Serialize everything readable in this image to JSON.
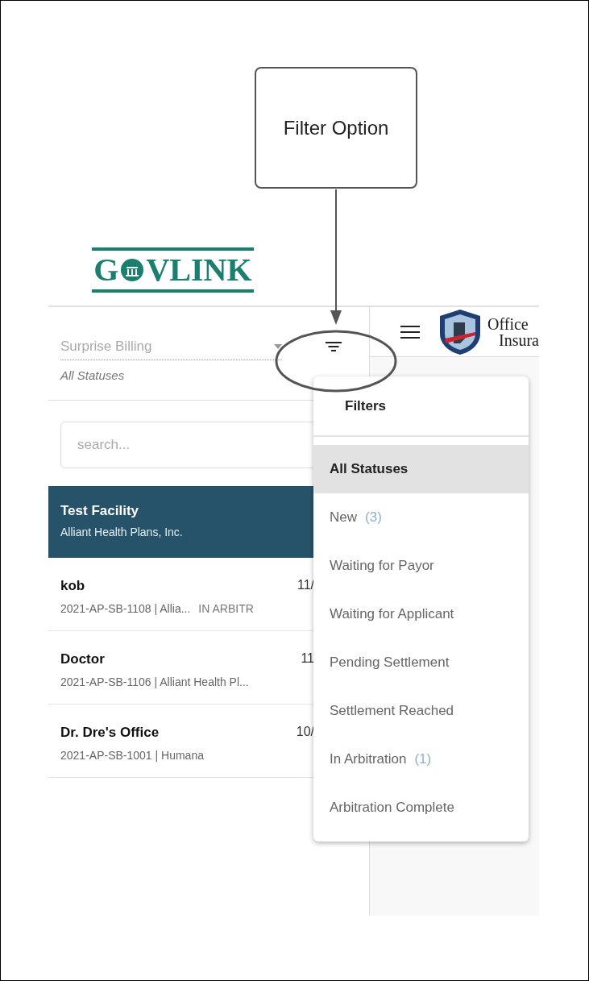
{
  "annotation": {
    "label": "Filter Option"
  },
  "logo": {
    "text_before": "G",
    "text_after": "VLINK"
  },
  "header": {
    "agency_name_lines": [
      "Office",
      "Insura"
    ]
  },
  "sidebar": {
    "program_select": {
      "value": "Surprise Billing"
    },
    "status_label": "All Statuses",
    "search": {
      "placeholder": "search..."
    },
    "cases": [
      {
        "title": "Test Facility",
        "subtitle": "Alliant Health Plans, Inc.",
        "selected": true
      },
      {
        "title": "kob",
        "date": "11/",
        "subtitle": "2021-AP-SB-1108 | Allia...",
        "status": "IN ARBITR",
        "selected": false
      },
      {
        "title": "Doctor",
        "date": "11",
        "subtitle": "2021-AP-SB-1106 | Alliant Health Pl...",
        "selected": false
      },
      {
        "title": "Dr. Dre's Office",
        "date": "10/",
        "subtitle": "2021-AP-SB-1001 | Humana",
        "selected": false
      }
    ]
  },
  "filter_menu": {
    "title": "Filters",
    "items": [
      {
        "label": "All Statuses",
        "selected": true
      },
      {
        "label": "New",
        "count": "(3)",
        "selected": false
      },
      {
        "label": "Waiting for Payor",
        "selected": false
      },
      {
        "label": "Waiting for Applicant",
        "selected": false
      },
      {
        "label": "Pending Settlement",
        "selected": false
      },
      {
        "label": "Settlement Reached",
        "selected": false
      },
      {
        "label": "In Arbitration",
        "count": "(1)",
        "selected": false
      },
      {
        "label": "Arbitration Complete",
        "selected": false
      }
    ]
  }
}
